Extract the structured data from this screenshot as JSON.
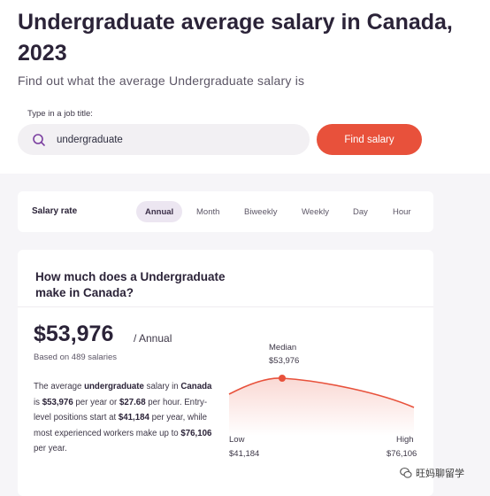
{
  "header": {
    "title": "Undergraduate average salary in Canada, 2023",
    "subtitle": "Find out what the average Undergraduate salary is"
  },
  "search": {
    "label": "Type in a job title:",
    "value": "undergraduate",
    "button": "Find salary"
  },
  "rate": {
    "label": "Salary rate",
    "tabs": [
      "Annual",
      "Month",
      "Biweekly",
      "Weekly",
      "Day",
      "Hour"
    ],
    "selected": "Annual"
  },
  "salary": {
    "question": "How much does a Undergraduate make in Canada?",
    "amount": "$53,976",
    "period": "/ Annual",
    "based_on": "Based on 489 salaries",
    "description": {
      "p1": "The average ",
      "job": "undergraduate",
      "p2": " salary in ",
      "country": "Canada",
      "p3": " is ",
      "annual": "$53,976",
      "p4": " per year or ",
      "hourly": "$27.68",
      "p5": " per hour. Entry-level positions start at ",
      "entry": "$41,184",
      "p6": " per year, while most experienced workers make up to ",
      "top": "$76,106",
      "p7": " per year."
    },
    "chart": {
      "median_label": "Median",
      "median_value": "$53,976",
      "low_label": "Low",
      "low_value": "$41,184",
      "high_label": "High",
      "high_value": "$76,106"
    }
  },
  "watermark": {
    "text": "旺妈聊留学"
  },
  "colors": {
    "accent": "#e8513b",
    "active_tab_bg": "#ece6f1",
    "search_icon": "#7b3fa0",
    "section_bg": "#f6f5f8"
  },
  "icons": {
    "search": "search-icon",
    "watermark": "wechat-icon"
  }
}
